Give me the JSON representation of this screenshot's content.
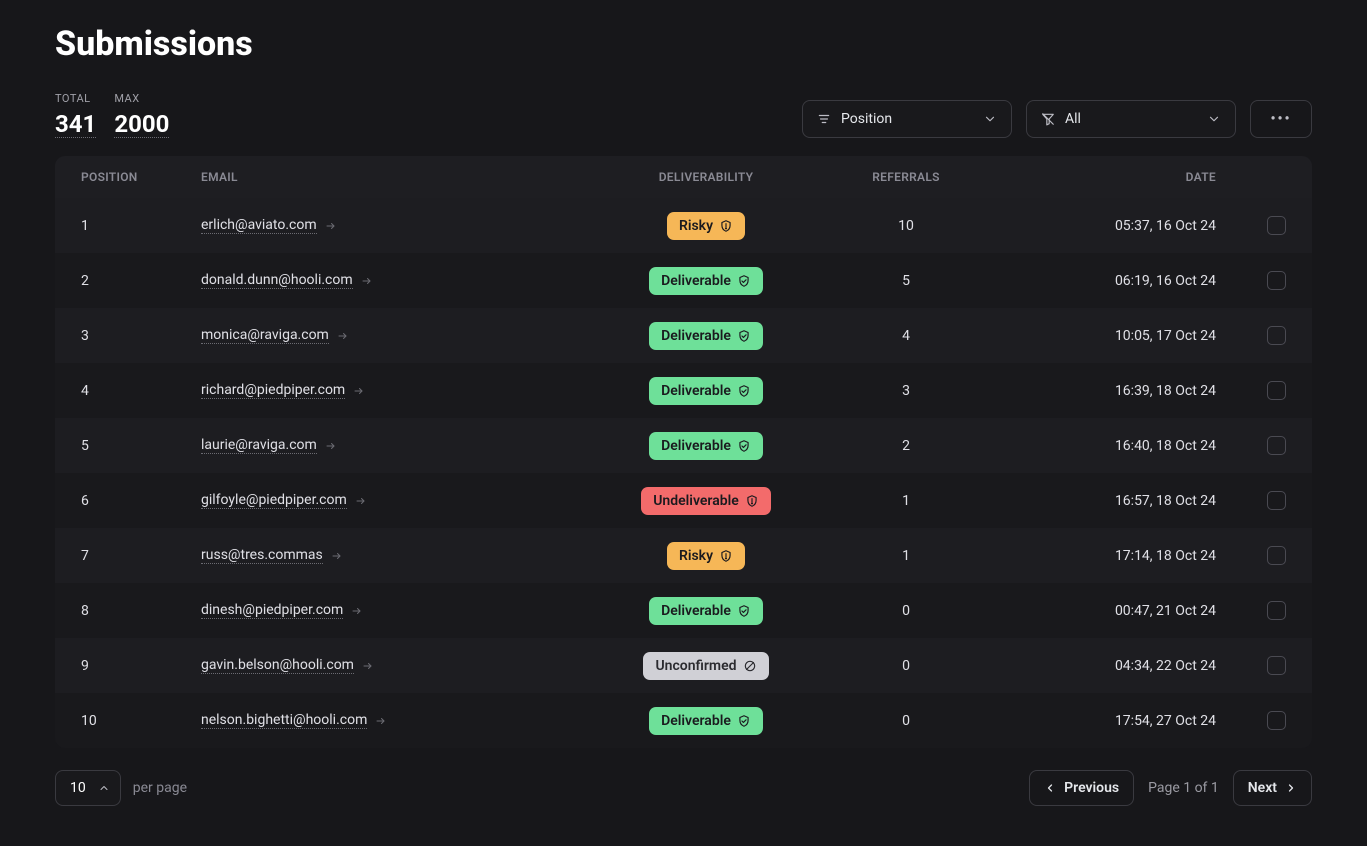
{
  "title": "Submissions",
  "stats": {
    "total_label": "TOTAL",
    "total_value": "341",
    "max_label": "MAX",
    "max_value": "2000"
  },
  "controls": {
    "sort_value": "Position",
    "filter_value": "All"
  },
  "columns": {
    "position": "POSITION",
    "email": "EMAIL",
    "deliverability": "DELIVERABILITY",
    "referrals": "REFERRALS",
    "date": "DATE"
  },
  "deliverability_labels": {
    "risky": "Risky",
    "deliverable": "Deliverable",
    "undeliverable": "Undeliverable",
    "unconfirmed": "Unconfirmed"
  },
  "rows": [
    {
      "position": "1",
      "email": "erlich@aviato.com",
      "deliverability": "risky",
      "referrals": "10",
      "date": "05:37, 16 Oct 24"
    },
    {
      "position": "2",
      "email": "donald.dunn@hooli.com",
      "deliverability": "deliverable",
      "referrals": "5",
      "date": "06:19, 16 Oct 24"
    },
    {
      "position": "3",
      "email": "monica@raviga.com",
      "deliverability": "deliverable",
      "referrals": "4",
      "date": "10:05, 17 Oct 24"
    },
    {
      "position": "4",
      "email": "richard@piedpiper.com",
      "deliverability": "deliverable",
      "referrals": "3",
      "date": "16:39, 18 Oct 24"
    },
    {
      "position": "5",
      "email": "laurie@raviga.com",
      "deliverability": "deliverable",
      "referrals": "2",
      "date": "16:40, 18 Oct 24"
    },
    {
      "position": "6",
      "email": "gilfoyle@piedpiper.com",
      "deliverability": "undeliverable",
      "referrals": "1",
      "date": "16:57, 18 Oct 24"
    },
    {
      "position": "7",
      "email": "russ@tres.commas",
      "deliverability": "risky",
      "referrals": "1",
      "date": "17:14, 18 Oct 24"
    },
    {
      "position": "8",
      "email": "dinesh@piedpiper.com",
      "deliverability": "deliverable",
      "referrals": "0",
      "date": "00:47, 21 Oct 24"
    },
    {
      "position": "9",
      "email": "gavin.belson@hooli.com",
      "deliverability": "unconfirmed",
      "referrals": "0",
      "date": "04:34, 22 Oct 24"
    },
    {
      "position": "10",
      "email": "nelson.bighetti@hooli.com",
      "deliverability": "deliverable",
      "referrals": "0",
      "date": "17:54, 27 Oct 24"
    }
  ],
  "pagination": {
    "per_page_value": "10",
    "per_page_label": "per page",
    "prev_label": "Previous",
    "page_info": "Page 1 of 1",
    "next_label": "Next"
  }
}
